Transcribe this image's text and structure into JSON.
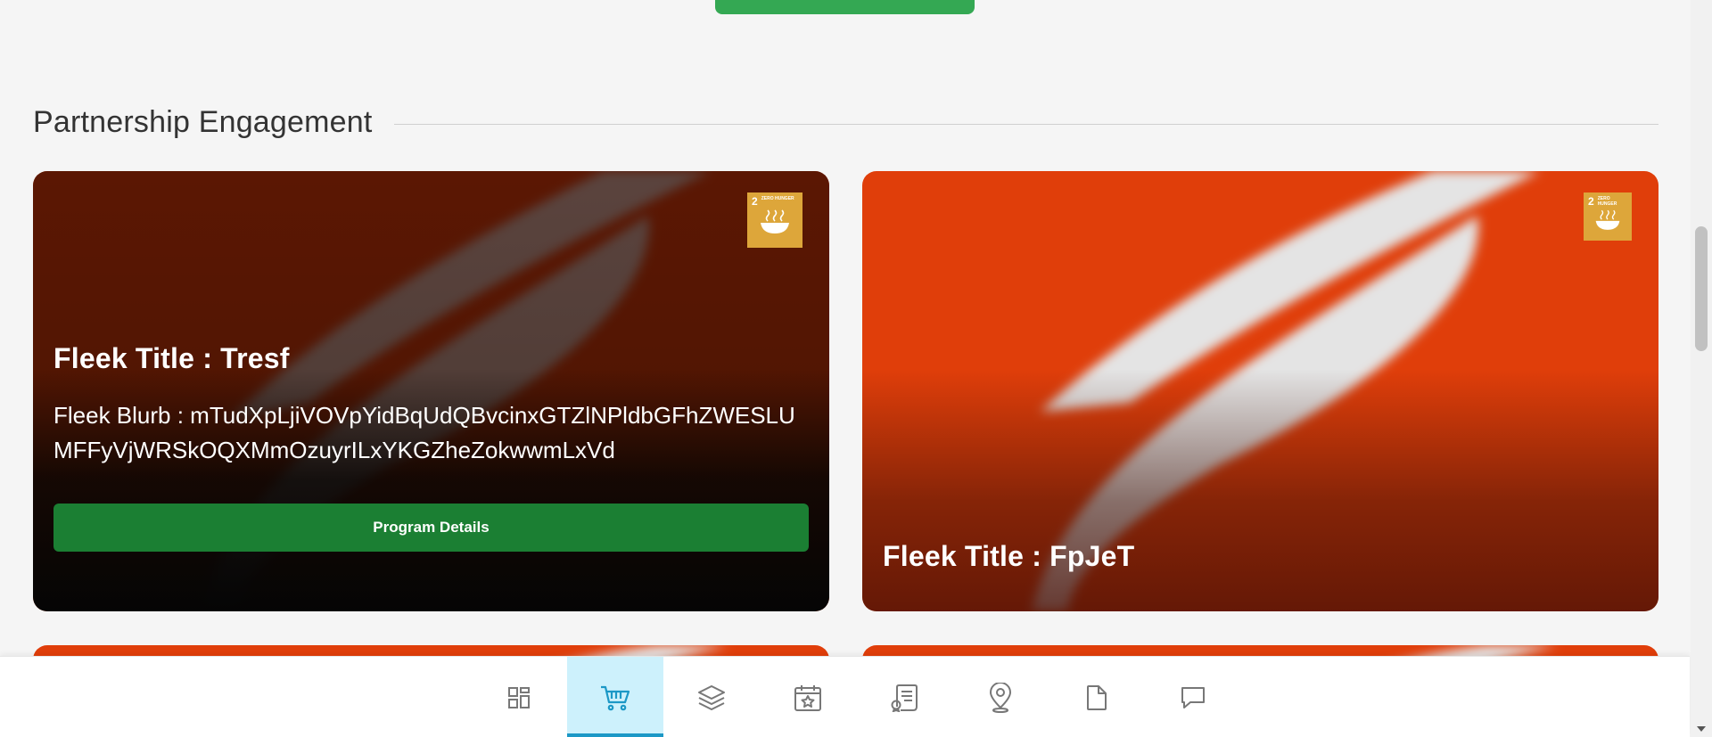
{
  "section": {
    "title": "Partnership Engagement"
  },
  "cards": [
    {
      "title": "Fleek Title : Tresf",
      "blurb": "Fleek Blurb : mTudXpLjiVOVpYidBqUdQBvcinxGTZlNPldbGFhZWESLUMFFyVjWRSkOQXMmOzuyrILxYKGZheZokwwmLxVd",
      "button_label": "Program Details",
      "badge": {
        "number": "2",
        "text": "ZERO HUNGER",
        "color": "#dda63a"
      }
    },
    {
      "title": "Fleek Title : FpJeT",
      "badge": {
        "number": "2",
        "text": "ZERO HUNGER",
        "color": "#dda63a"
      }
    }
  ],
  "bottom_nav": {
    "items": [
      {
        "icon": "dashboard-icon"
      },
      {
        "icon": "cart-icon",
        "active": true
      },
      {
        "icon": "layers-icon"
      },
      {
        "icon": "calendar-star-icon"
      },
      {
        "icon": "certificate-list-icon"
      },
      {
        "icon": "map-pin-icon"
      },
      {
        "icon": "document-icon"
      },
      {
        "icon": "chat-icon"
      }
    ]
  },
  "colors": {
    "accent_green": "#1b7f33",
    "top_green": "#34a853",
    "brand_orange": "#e03e0a",
    "nav_active_bg": "#cdf1fc",
    "nav_active_bar": "#1c98c6"
  }
}
